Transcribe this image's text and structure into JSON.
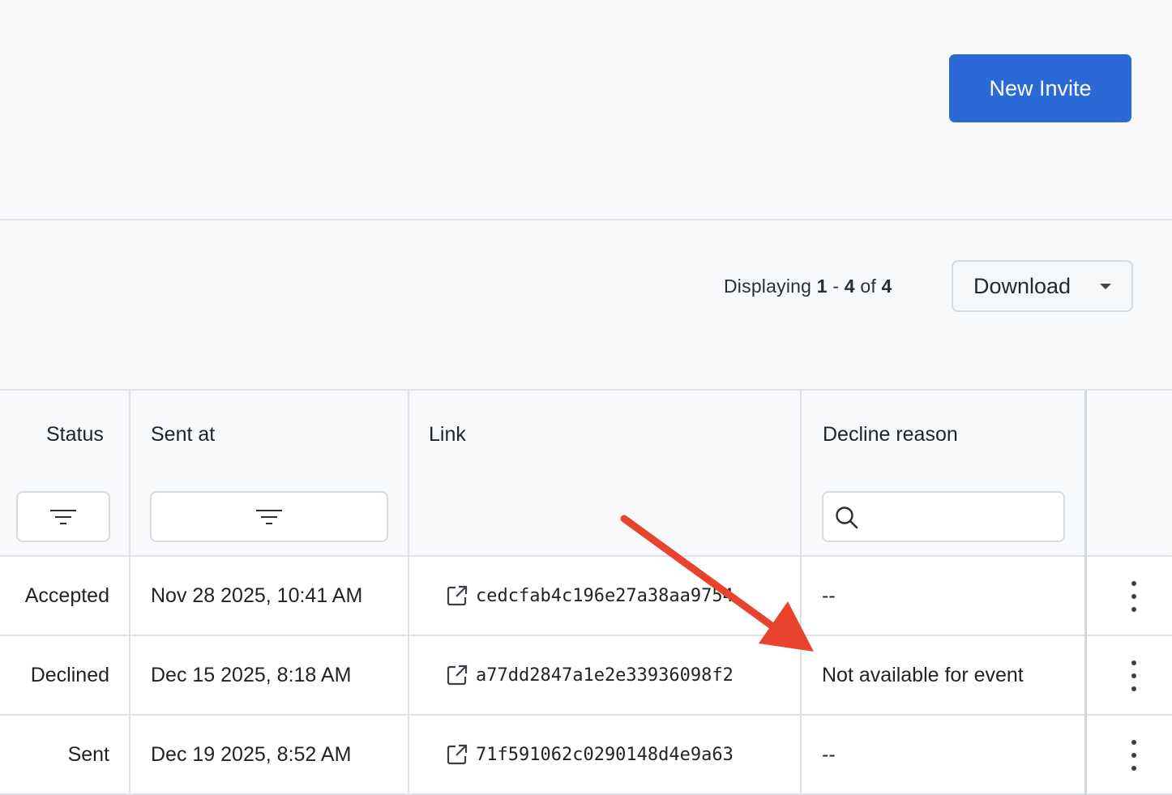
{
  "header": {
    "new_invite_label": "New Invite"
  },
  "toolbar": {
    "display_prefix": "Displaying",
    "range_start": "1",
    "range_sep": "-",
    "range_end": "4",
    "of_label": "of",
    "total": "4",
    "download_label": "Download"
  },
  "table": {
    "columns": {
      "status": "Status",
      "sent_at": "Sent at",
      "link": "Link",
      "decline_reason": "Decline reason"
    },
    "search_placeholder": "",
    "rows": [
      {
        "status": "Accepted",
        "sent_at": "Nov 28 2025, 10:41 AM",
        "link": "cedcfab4c196e27a38aa9754",
        "decline_reason": "--"
      },
      {
        "status": "Declined",
        "sent_at": "Dec 15 2025, 8:18 AM",
        "link": "a77dd2847a1e2e33936098f2",
        "decline_reason": "Not available for event"
      },
      {
        "status": "Sent",
        "sent_at": "Dec 19 2025, 8:52 AM",
        "link": "71f591062c0290148d4e9a63",
        "decline_reason": "--"
      }
    ]
  },
  "colors": {
    "primary": "#2a69d6",
    "annotation_arrow": "#e8432e",
    "border": "#dfe1e5",
    "background": "#f8f9fb"
  },
  "icons": [
    "filter-icon",
    "search-icon",
    "external-link-icon",
    "more-vertical-icon",
    "chevron-down-icon"
  ]
}
